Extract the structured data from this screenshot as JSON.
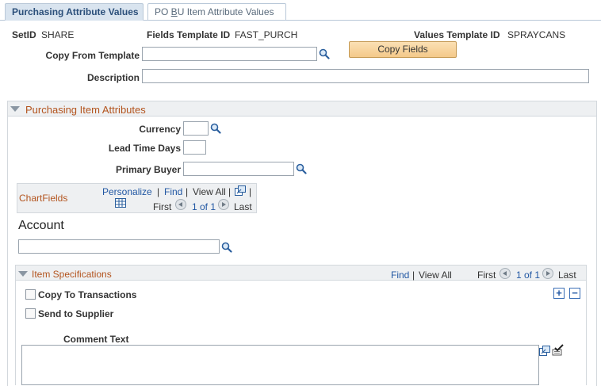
{
  "tabs": [
    {
      "label": "Purchasing Attribute Values",
      "active": true
    },
    {
      "label_pre": "PO ",
      "label_ul": "B",
      "label_post": "U Item Attribute Values",
      "active": false
    }
  ],
  "header": {
    "setid_label": "SetID",
    "setid_value": "SHARE",
    "fields_template_label": "Fields Template ID",
    "fields_template_value": "FAST_PURCH",
    "values_template_label": "Values Template ID",
    "values_template_value": "SPRAYCANS",
    "copy_from_label": "Copy From Template",
    "copy_from_value": "",
    "copy_fields_button": "Copy Fields",
    "description_label": "Description",
    "description_value": ""
  },
  "purchasing": {
    "title": "Purchasing Item Attributes",
    "currency_label": "Currency",
    "lead_time_label": "Lead Time Days",
    "buyer_label": "Primary Buyer"
  },
  "chartfields": {
    "title": "ChartFields",
    "personalize": "Personalize",
    "sep": "|",
    "find": "Find",
    "view_all": "View All",
    "first": "First",
    "page": "1 of 1",
    "last": "Last",
    "account_label": "Account",
    "account_value": ""
  },
  "item_specs": {
    "title": "Item Specifications",
    "find": "Find",
    "sep": "|",
    "view_all": "View All",
    "first": "First",
    "page": "1 of 1",
    "last": "Last",
    "add": "+",
    "remove": "−",
    "copy_to_transactions": "Copy To Transactions",
    "send_to_supplier": "Send to Supplier",
    "comment_label": "Comment Text",
    "comment_value": ""
  },
  "colors": {
    "section_title": "#b3541e",
    "link": "#2157a3",
    "button_bg": "#f4c98a"
  }
}
